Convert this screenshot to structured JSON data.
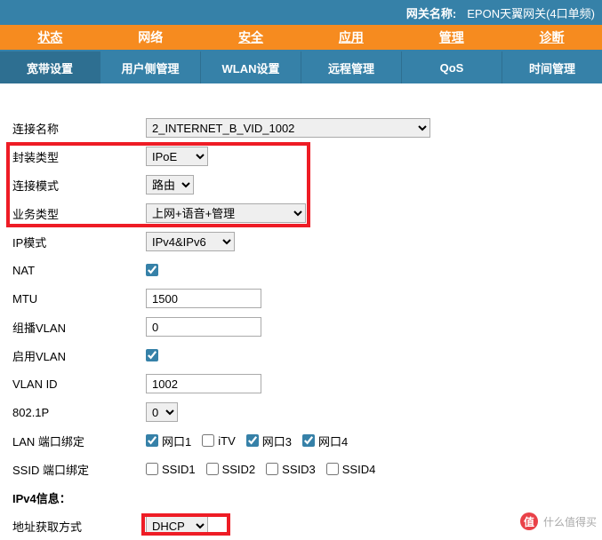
{
  "header": {
    "gateway_name_label": "网关名称:",
    "gateway_name_value": "EPON天翼网关(4口单频)"
  },
  "main_nav": [
    "状态",
    "网络",
    "安全",
    "应用",
    "管理",
    "诊断"
  ],
  "sub_nav": [
    "宽带设置",
    "用户侧管理",
    "WLAN设置",
    "远程管理",
    "QoS",
    "时间管理"
  ],
  "form": {
    "conn_name": {
      "label": "连接名称",
      "value": "2_INTERNET_B_VID_1002"
    },
    "encap": {
      "label": "封装类型",
      "value": "IPoE"
    },
    "conn_mode": {
      "label": "连接模式",
      "value": "路由"
    },
    "biz_type": {
      "label": "业务类型",
      "value": "上网+语音+管理"
    },
    "ip_mode": {
      "label": "IP模式",
      "value": "IPv4&IPv6"
    },
    "nat": {
      "label": "NAT"
    },
    "mtu": {
      "label": "MTU",
      "value": "1500"
    },
    "mc_vlan": {
      "label": "组播VLAN",
      "value": "0"
    },
    "vlan_en": {
      "label": "启用VLAN"
    },
    "vlan_id": {
      "label": "VLAN ID",
      "value": "1002"
    },
    "p8021": {
      "label": "802.1P",
      "value": "0"
    },
    "lan_bind": {
      "label": "LAN 端口绑定",
      "opts": [
        "网口1",
        "iTV",
        "网口3",
        "网口4"
      ],
      "checked": [
        true,
        false,
        true,
        true
      ]
    },
    "ssid_bind": {
      "label": "SSID 端口绑定",
      "opts": [
        "SSID1",
        "SSID2",
        "SSID3",
        "SSID4"
      ]
    },
    "ipv4_info": {
      "label": "IPv4信息："
    },
    "addr_mode": {
      "label": "地址获取方式",
      "value": "DHCP"
    }
  },
  "watermark": {
    "logo": "值",
    "text": "什么值得买"
  }
}
